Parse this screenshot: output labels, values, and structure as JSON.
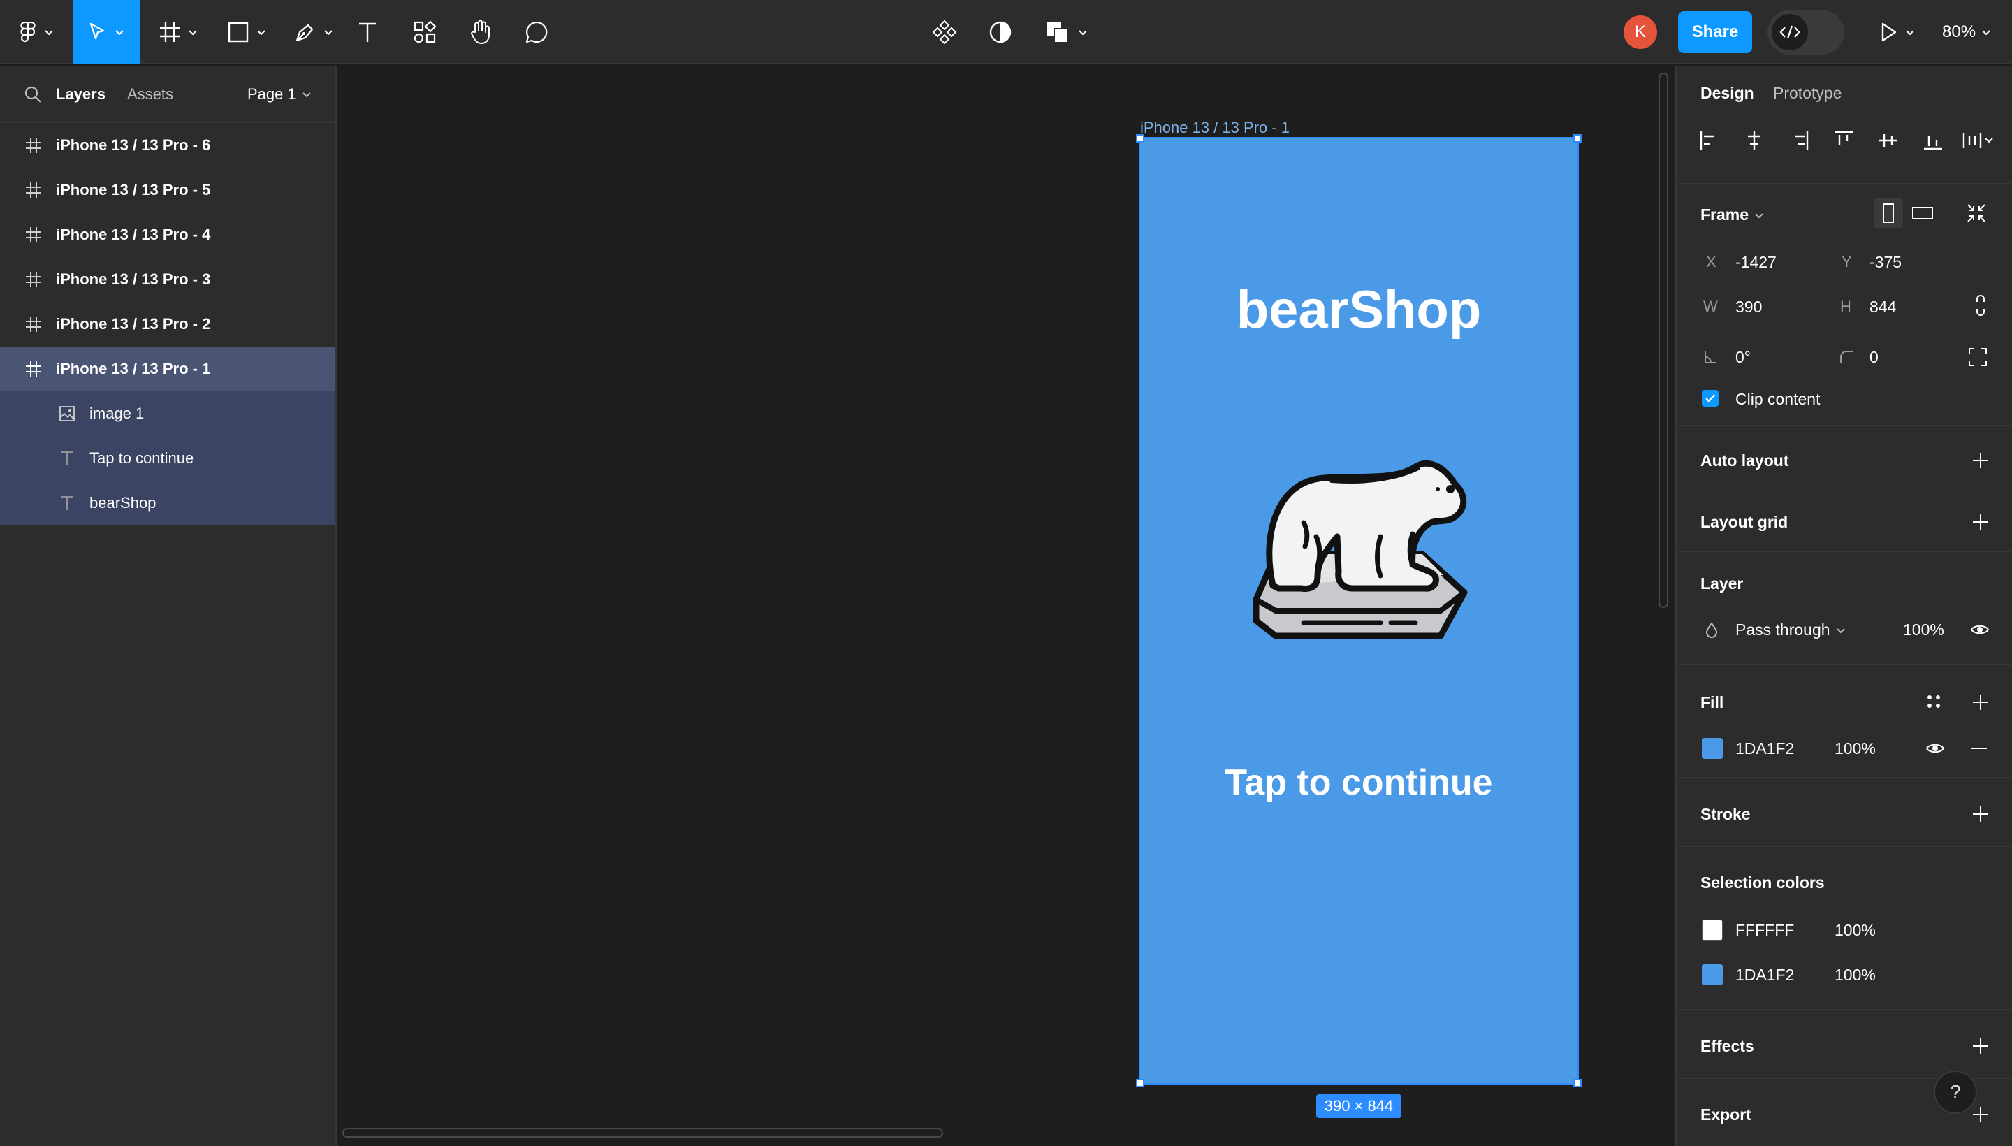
{
  "toolbar": {
    "share_label": "Share",
    "avatar_initial": "K",
    "zoom_label": "80%",
    "tools": [
      "main-menu",
      "move",
      "frame",
      "shape",
      "pen",
      "text",
      "resources",
      "hand",
      "comment"
    ],
    "center_tools": [
      "components",
      "mask",
      "boolean"
    ]
  },
  "left_panel": {
    "tabs": {
      "layers": "Layers",
      "assets": "Assets"
    },
    "page_label": "Page 1",
    "layers": [
      {
        "label": "iPhone 13 / 13 Pro - 6",
        "icon": "frame-icon"
      },
      {
        "label": "iPhone 13 / 13 Pro - 5",
        "icon": "frame-icon"
      },
      {
        "label": "iPhone 13 / 13 Pro - 4",
        "icon": "frame-icon"
      },
      {
        "label": "iPhone 13 / 13 Pro - 3",
        "icon": "frame-icon"
      },
      {
        "label": "iPhone 13 / 13 Pro - 2",
        "icon": "frame-icon"
      },
      {
        "label": "iPhone 13 / 13 Pro - 1",
        "icon": "frame-icon",
        "selected": true
      }
    ],
    "children": [
      {
        "label": "image 1",
        "icon": "image-icon"
      },
      {
        "label": "Tap to continue",
        "icon": "text-icon"
      },
      {
        "label": "bearShop",
        "icon": "text-icon"
      }
    ]
  },
  "canvas": {
    "frame_label": "iPhone 13 / 13 Pro - 1",
    "frame_title": "bearShop",
    "frame_cta": "Tap to continue",
    "size_badge": "390 × 844",
    "frame_color": "#4a9ae8"
  },
  "right_panel": {
    "tabs": {
      "design": "Design",
      "prototype": "Prototype"
    },
    "frame": {
      "title": "Frame",
      "x_label": "X",
      "x": "-1427",
      "y_label": "Y",
      "y": "-375",
      "w_label": "W",
      "w": "390",
      "h_label": "H",
      "h": "844",
      "rotation": "0°",
      "radius": "0",
      "clip_label": "Clip content"
    },
    "auto_layout": "Auto layout",
    "layout_grid": "Layout grid",
    "layer": {
      "title": "Layer",
      "blend": "Pass through",
      "opacity": "100%"
    },
    "fill": {
      "title": "Fill",
      "hex": "1DA1F2",
      "opacity": "100%",
      "color": "#4a9ae8"
    },
    "stroke": "Stroke",
    "selection_colors": {
      "title": "Selection colors",
      "items": [
        {
          "hex": "FFFFFF",
          "opacity": "100%",
          "color": "#ffffff"
        },
        {
          "hex": "1DA1F2",
          "opacity": "100%",
          "color": "#4a9ae8"
        }
      ]
    },
    "effects": "Effects",
    "export": "Export"
  },
  "help_label": "?"
}
